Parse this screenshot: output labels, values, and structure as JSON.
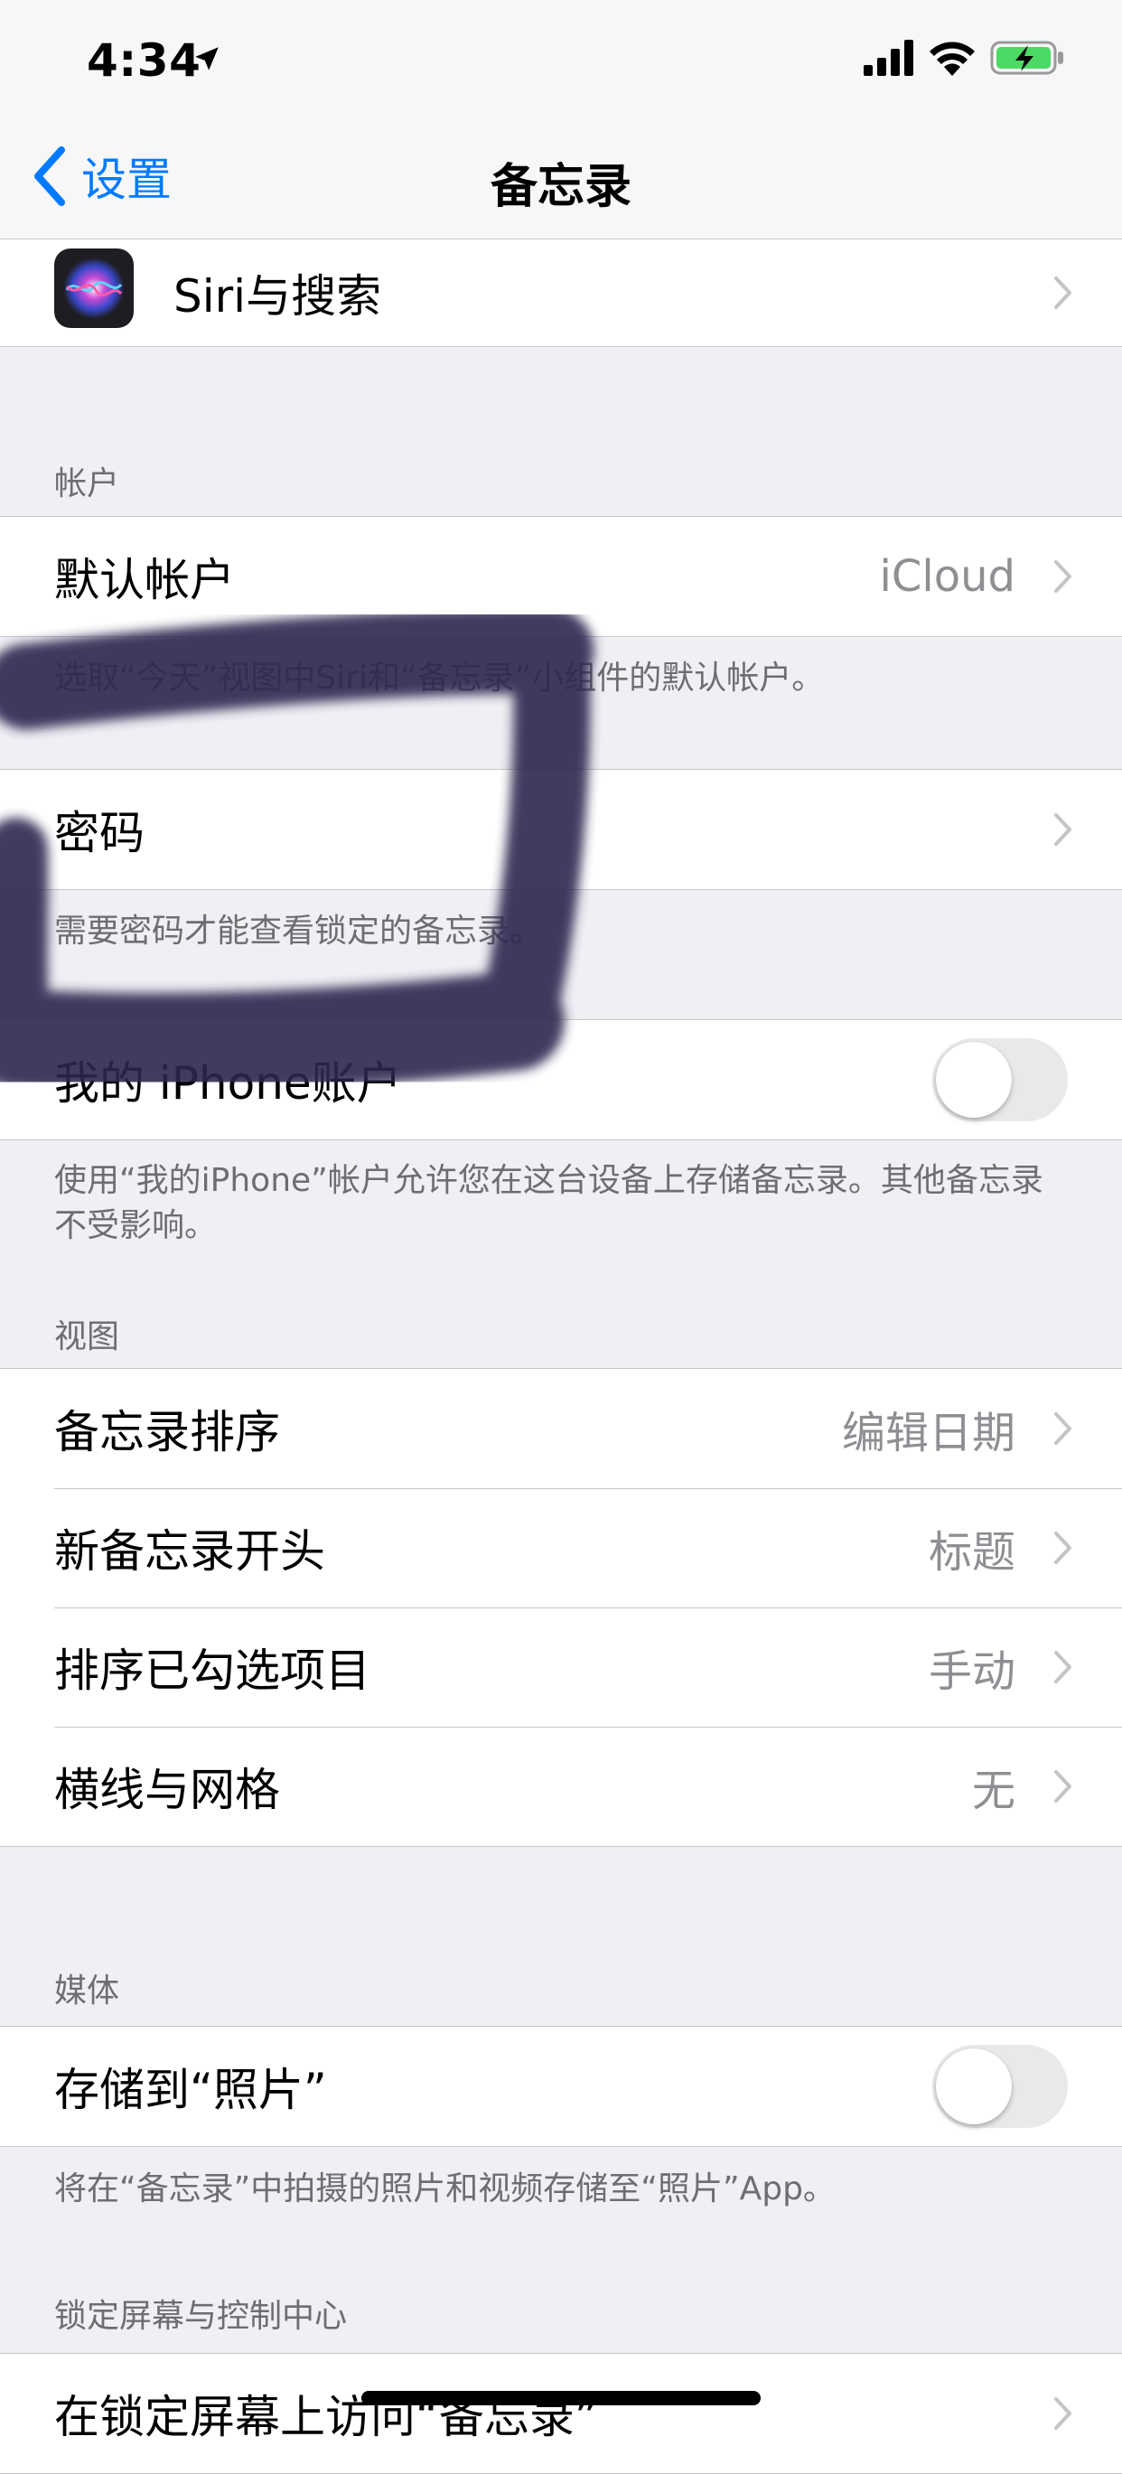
{
  "status": {
    "time": "4:34"
  },
  "nav": {
    "back_label": "设置",
    "title": "备忘录"
  },
  "siri": {
    "label": "Siri与搜索"
  },
  "accounts": {
    "header": "帐户",
    "default_label": "默认帐户",
    "default_value": "iCloud",
    "default_footer": "选取“今天”视图中Siri和“备忘录”小组件的默认帐户。",
    "password_label": "密码",
    "password_footer": "需要密码才能查看锁定的备忘录。",
    "iphone_label": "我的 iPhone账户",
    "iphone_toggle_on": false,
    "iphone_footer": "使用“我的iPhone”帐户允许您在这台设备上存储备忘录。其他备忘录不受影响。"
  },
  "view": {
    "header": "视图",
    "rows": [
      {
        "label": "备忘录排序",
        "value": "编辑日期"
      },
      {
        "label": "新备忘录开头",
        "value": "标题"
      },
      {
        "label": "排序已勾选项目",
        "value": "手动"
      },
      {
        "label": "横线与网格",
        "value": "无"
      }
    ]
  },
  "media": {
    "header": "媒体",
    "save_label": "存储到“照片”",
    "save_toggle_on": false,
    "footer": "将在“备忘录”中拍摄的照片和视频存储至“照片”App。"
  },
  "lock": {
    "header": "锁定屏幕与控制中心",
    "access_label": "在锁定屏幕上访问“备忘录”"
  },
  "colors": {
    "accent": "#007aff",
    "background": "#efeff4",
    "scribble": "#2e2650"
  }
}
